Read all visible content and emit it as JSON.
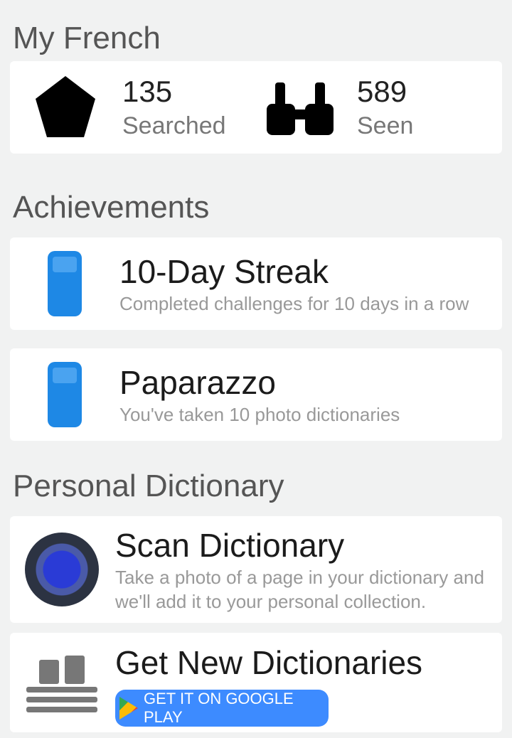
{
  "my_french": {
    "title": "My French",
    "stats": [
      {
        "icon": "star-icon",
        "value": "135",
        "label": "Searched"
      },
      {
        "icon": "binoculars-icon",
        "value": "589",
        "label": "Seen"
      }
    ]
  },
  "achievements": {
    "title": "Achievements",
    "items": [
      {
        "icon": "phone-icon",
        "title": "10-Day Streak",
        "subtitle": "Completed challenges for 10 days in a row"
      },
      {
        "icon": "phone-icon",
        "title": "Paparazzo",
        "subtitle": "You've taken 10 photo dictionaries"
      }
    ]
  },
  "personal_dictionary": {
    "title": "Personal Dictionary",
    "scan": {
      "icon": "scan-icon",
      "title": "Scan Dictionary",
      "subtitle": "Take a photo of a page in your dictionary and we'll add it to your personal collection."
    },
    "get_new": {
      "icon": "books-icon",
      "title": "Get New Dictionaries",
      "store_button_label": "GET IT ON GOOGLE PLAY"
    }
  },
  "colors": {
    "accent": "#1e88e5",
    "background": "#f1f2f2",
    "play_button": "#3d8bff"
  }
}
